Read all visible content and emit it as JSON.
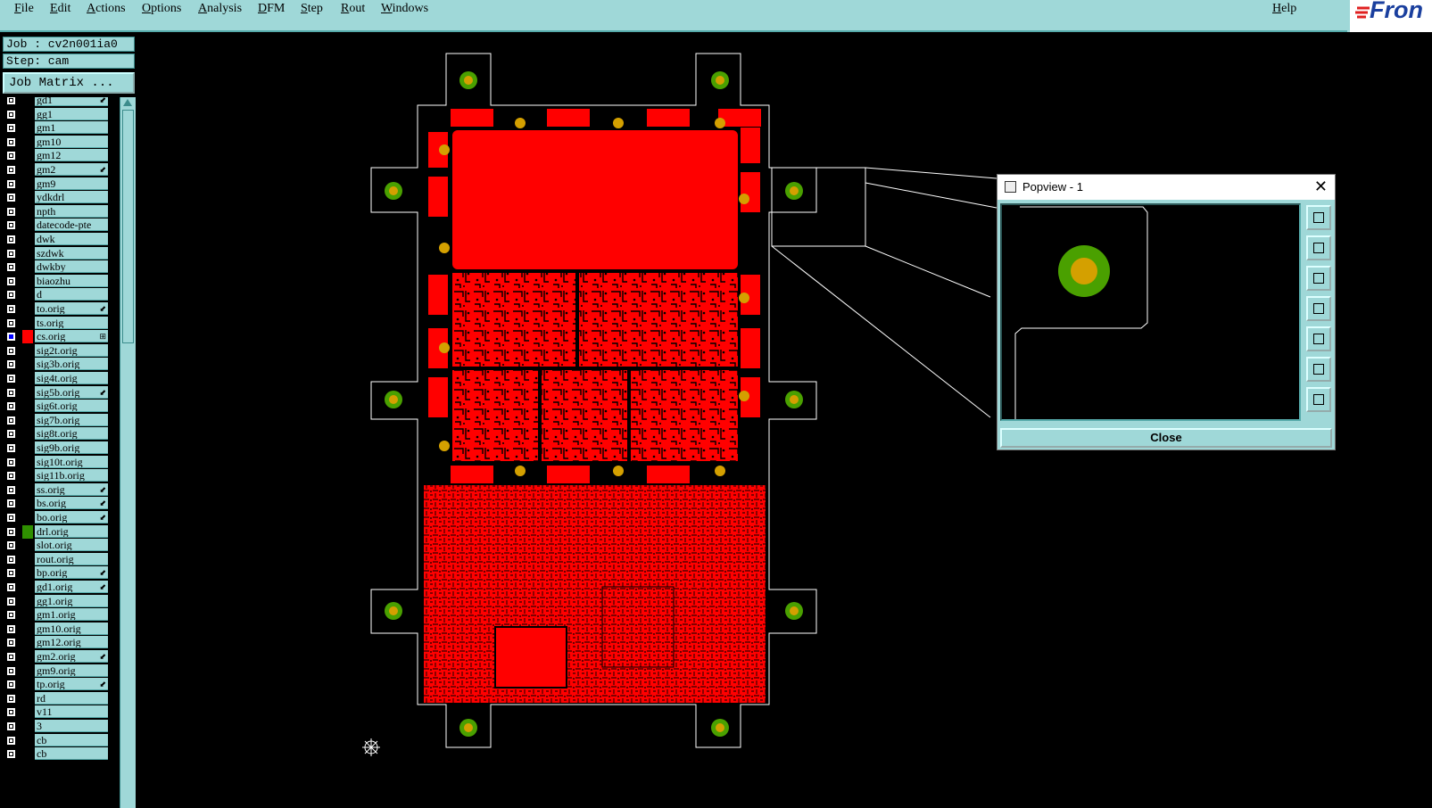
{
  "menubar": {
    "items": [
      "File",
      "Edit",
      "Actions",
      "Options",
      "Analysis",
      "DFM",
      "Step",
      "Rout",
      "Windows"
    ],
    "help": "Help"
  },
  "logo": {
    "text": "Fron",
    "icon": "frontline-logo-icon"
  },
  "sidebar": {
    "job": "Job : cv2n001ia0",
    "step": "Step: cam",
    "job_matrix": "Job Matrix ...",
    "layers": [
      {
        "name": "gd1",
        "flag": "⬋",
        "active": false,
        "swatch": ""
      },
      {
        "name": "gg1",
        "flag": "",
        "active": false,
        "swatch": ""
      },
      {
        "name": "gm1",
        "flag": "",
        "active": false,
        "swatch": ""
      },
      {
        "name": "gm10",
        "flag": "",
        "active": false,
        "swatch": ""
      },
      {
        "name": "gm12",
        "flag": "",
        "active": false,
        "swatch": ""
      },
      {
        "name": "gm2",
        "flag": "⬋",
        "active": false,
        "swatch": ""
      },
      {
        "name": "gm9",
        "flag": "",
        "active": false,
        "swatch": ""
      },
      {
        "name": "ydkdrl",
        "flag": "",
        "active": false,
        "swatch": ""
      },
      {
        "name": "npth",
        "flag": "",
        "active": false,
        "swatch": ""
      },
      {
        "name": "datecode-pte",
        "flag": "",
        "active": false,
        "swatch": ""
      },
      {
        "name": "dwk",
        "flag": "",
        "active": false,
        "swatch": ""
      },
      {
        "name": "szdwk",
        "flag": "",
        "active": false,
        "swatch": ""
      },
      {
        "name": "dwkby",
        "flag": "",
        "active": false,
        "swatch": ""
      },
      {
        "name": "biaozhu",
        "flag": "",
        "active": false,
        "swatch": ""
      },
      {
        "name": "d",
        "flag": "",
        "active": false,
        "swatch": ""
      },
      {
        "name": "to.orig",
        "flag": "⬋",
        "active": false,
        "swatch": ""
      },
      {
        "name": "ts.orig",
        "flag": "",
        "active": false,
        "swatch": ""
      },
      {
        "name": "cs.orig",
        "flag": "⊞",
        "active": true,
        "swatch": "#ff0000"
      },
      {
        "name": "sig2t.orig",
        "flag": "",
        "active": false,
        "swatch": ""
      },
      {
        "name": "sig3b.orig",
        "flag": "",
        "active": false,
        "swatch": ""
      },
      {
        "name": "sig4t.orig",
        "flag": "",
        "active": false,
        "swatch": ""
      },
      {
        "name": "sig5b.orig",
        "flag": "⬋",
        "active": false,
        "swatch": ""
      },
      {
        "name": "sig6t.orig",
        "flag": "",
        "active": false,
        "swatch": ""
      },
      {
        "name": "sig7b.orig",
        "flag": "",
        "active": false,
        "swatch": ""
      },
      {
        "name": "sig8t.orig",
        "flag": "",
        "active": false,
        "swatch": ""
      },
      {
        "name": "sig9b.orig",
        "flag": "",
        "active": false,
        "swatch": ""
      },
      {
        "name": "sig10t.orig",
        "flag": "",
        "active": false,
        "swatch": ""
      },
      {
        "name": "sig11b.orig",
        "flag": "",
        "active": false,
        "swatch": ""
      },
      {
        "name": "ss.orig",
        "flag": "⬋",
        "active": false,
        "swatch": ""
      },
      {
        "name": "bs.orig",
        "flag": "⬋",
        "active": false,
        "swatch": ""
      },
      {
        "name": "bo.orig",
        "flag": "⬋",
        "active": false,
        "swatch": ""
      },
      {
        "name": "drl.orig",
        "flag": "",
        "active": false,
        "swatch": "#2f8f00"
      },
      {
        "name": "slot.orig",
        "flag": "",
        "active": false,
        "swatch": ""
      },
      {
        "name": "rout.orig",
        "flag": "",
        "active": false,
        "swatch": ""
      },
      {
        "name": "bp.orig",
        "flag": "⬋",
        "active": false,
        "swatch": ""
      },
      {
        "name": "gd1.orig",
        "flag": "⬋",
        "active": false,
        "swatch": ""
      },
      {
        "name": "gg1.orig",
        "flag": "",
        "active": false,
        "swatch": ""
      },
      {
        "name": "gm1.orig",
        "flag": "",
        "active": false,
        "swatch": ""
      },
      {
        "name": "gm10.orig",
        "flag": "",
        "active": false,
        "swatch": ""
      },
      {
        "name": "gm12.orig",
        "flag": "",
        "active": false,
        "swatch": ""
      },
      {
        "name": "gm2.orig",
        "flag": "⬋",
        "active": false,
        "swatch": ""
      },
      {
        "name": "gm9.orig",
        "flag": "",
        "active": false,
        "swatch": ""
      },
      {
        "name": "tp.orig",
        "flag": "⬋",
        "active": false,
        "swatch": ""
      },
      {
        "name": "rd",
        "flag": "",
        "active": false,
        "swatch": ""
      },
      {
        "name": "v11",
        "flag": "",
        "active": false,
        "swatch": ""
      },
      {
        "name": "3",
        "flag": "",
        "active": false,
        "swatch": ""
      },
      {
        "name": "cb",
        "flag": "",
        "active": false,
        "swatch": ""
      },
      {
        "name": "cb",
        "flag": "",
        "active": false,
        "swatch": ""
      }
    ]
  },
  "popview": {
    "title": "Popview - 1",
    "close_label": "Close",
    "close_icon": "close-icon",
    "tools": [
      "zoom-fit-icon",
      "pan-up-icon",
      "pan-down-icon",
      "pan-left-icon",
      "pan-right-icon",
      "zoom-in-icon",
      "zoom-out-icon"
    ]
  },
  "colors": {
    "menubar": "#9fd8d8",
    "copper": "#ff0000",
    "drill_pad": "#4aa000",
    "drill_hole": "#d4a000",
    "background": "#000000",
    "profile": "#ffffff"
  }
}
